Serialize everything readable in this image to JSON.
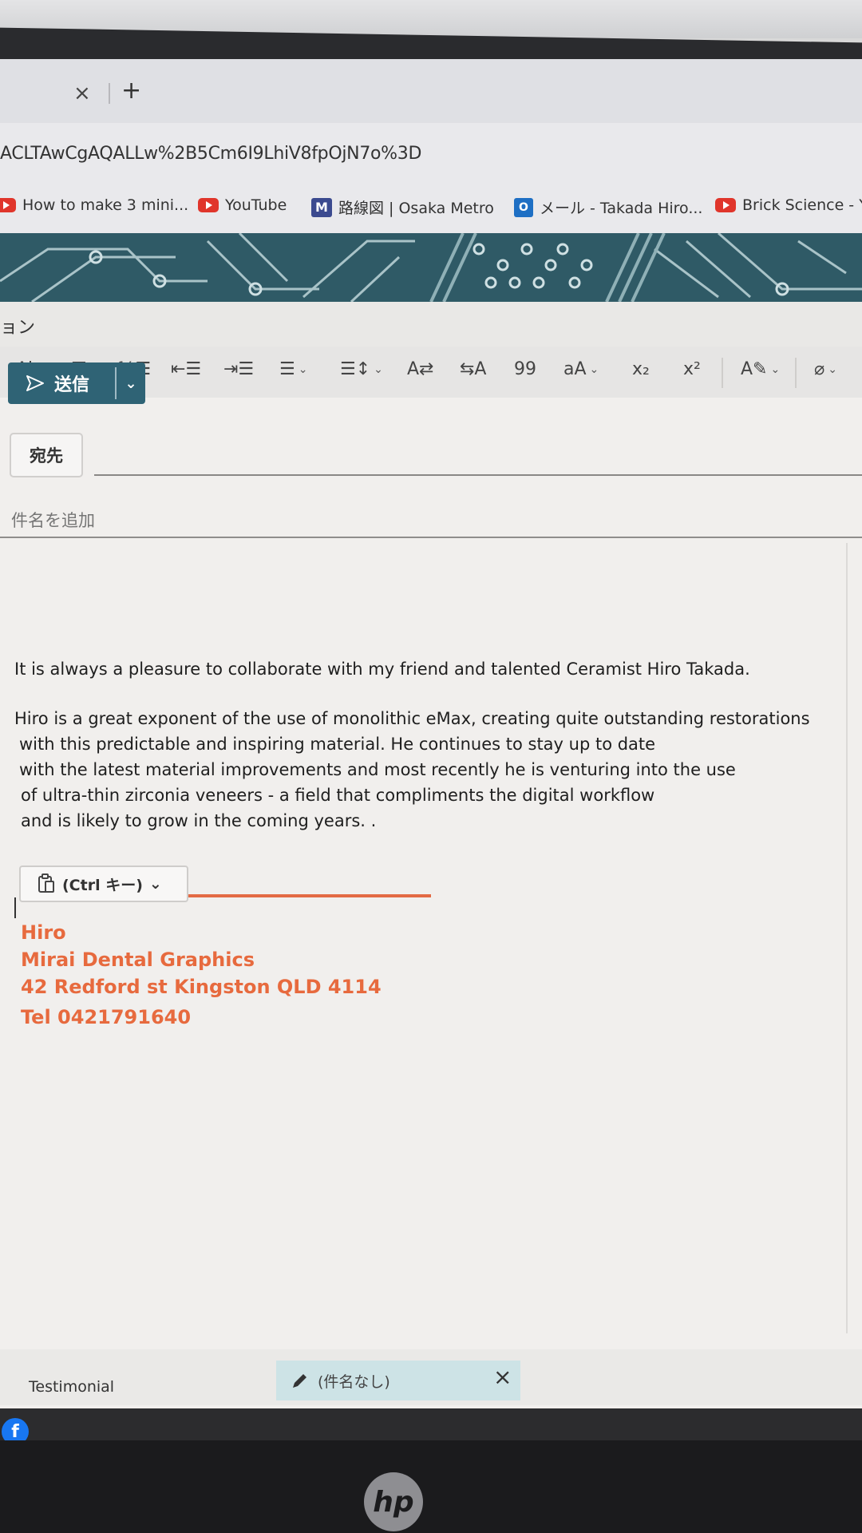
{
  "browser": {
    "tab_close": "×",
    "tab_new": "+",
    "address": "ACLTAwCgAQALLw%2B5Cm6I9LhiV8fpOjN7o%3D",
    "bookmarks": [
      {
        "label": "How to make 3 mini...",
        "icon": "youtube-icon"
      },
      {
        "label": "YouTube",
        "icon": "youtube-icon"
      },
      {
        "label": "路線図 | Osaka Metro",
        "icon": "metro-icon",
        "icon_text": "M"
      },
      {
        "label": "メール - Takada Hiro...",
        "icon": "outlook-icon",
        "icon_text": "O"
      },
      {
        "label": "Brick Science - Yo",
        "icon": "youtube-icon"
      }
    ]
  },
  "app": {
    "label": "ョン"
  },
  "toolbar": {
    "items": [
      {
        "name": "spelling-icon",
        "glyph": "A͈b"
      },
      {
        "name": "bullets-icon",
        "glyph": "⁝☰"
      },
      {
        "name": "numbering-icon",
        "glyph": "⅓☰"
      },
      {
        "name": "decrease-indent-icon",
        "glyph": "⇤☰"
      },
      {
        "name": "increase-indent-icon",
        "glyph": "⇥☰"
      },
      {
        "name": "align-icon",
        "glyph": "☰"
      },
      {
        "name": "line-spacing-icon",
        "glyph": "☰↕"
      },
      {
        "name": "ltr-icon",
        "glyph": "A⇄"
      },
      {
        "name": "rtl-icon",
        "glyph": "⇆A"
      },
      {
        "name": "quote-icon",
        "glyph": "99"
      },
      {
        "name": "change-case-icon",
        "glyph": "aA"
      },
      {
        "name": "subscript-icon",
        "glyph": "x₂"
      },
      {
        "name": "superscript-icon",
        "glyph": "x²"
      },
      {
        "name": "styles-icon",
        "glyph": "A✎"
      },
      {
        "name": "attach-icon",
        "glyph": "⌀"
      }
    ],
    "chevron": "⌄"
  },
  "compose": {
    "send_label": "送信",
    "send_icon": "send-icon",
    "send_dropdown": "⌄",
    "to_label": "宛先",
    "subject_placeholder": "件名を追加",
    "body": [
      "It is always a pleasure to collaborate with my friend and talented Ceramist Hiro Takada.",
      "Hiro is a great exponent of the use of monolithic eMax, creating quite outstanding restorations",
      "with this predictable and inspiring material. He continues to stay up to date",
      "with the latest material improvements and most recently he is venturing into the use",
      "of ultra-thin zirconia veneers - a field that compliments the digital workflow",
      "and is likely to grow in the coming years. ."
    ],
    "paste_options": "(Ctrl キー)",
    "paste_chevron": "⌄",
    "signature": {
      "name": "Hiro",
      "company": "Mirai Dental Graphics",
      "address": "42 Redford st Kingston QLD 4114",
      "phone": "Tel 0421791640"
    },
    "signature_color": "#e76a3e"
  },
  "draftbar": {
    "left_label": "Testimonial",
    "draft_title": "(件名なし)",
    "close": "×"
  },
  "colors": {
    "send_button": "#2f6375",
    "banner": "#2f5a66"
  }
}
